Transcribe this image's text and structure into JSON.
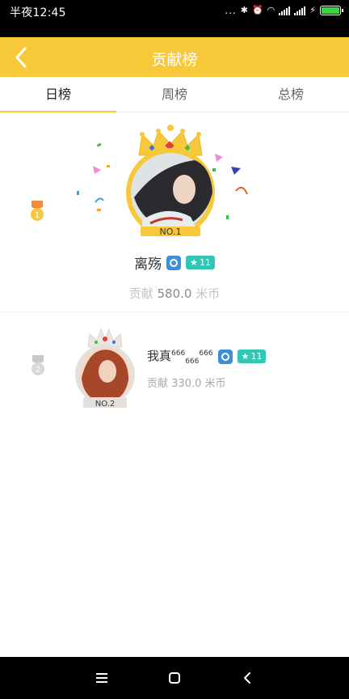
{
  "status_bar": {
    "time": "半夜12:45",
    "dots": "...",
    "bluetooth_icon": "bluetooth-icon",
    "alarm_icon": "alarm-icon",
    "wifi_icon": "wifi-icon"
  },
  "header": {
    "back_icon": "chevron-left-icon",
    "title": "贡献榜"
  },
  "tabs": [
    {
      "label": "日榜",
      "active": true
    },
    {
      "label": "周榜",
      "active": false
    },
    {
      "label": "总榜",
      "active": false
    }
  ],
  "ranking": [
    {
      "rank": 1,
      "rank_label": "NO.1",
      "medal_number": "1",
      "name": "离殇",
      "level": "11",
      "contribution_label": "贡献",
      "contribution_value": "580.0",
      "unit": "米币"
    },
    {
      "rank": 2,
      "rank_label": "NO.2",
      "medal_number": "2",
      "name_parts": [
        "我真",
        "666",
        "666",
        "666"
      ],
      "level": "11",
      "contribution_label": "贡献",
      "contribution_value": "330.0",
      "unit": "米币"
    }
  ],
  "nav": {
    "menu_icon": "menu-icon",
    "home_icon": "home-square-icon",
    "back_icon": "back-triangle-icon"
  },
  "colors": {
    "header_bg": "#f6c83a",
    "tab_indicator": "#f6c83a",
    "badge_blue": "#3c8fd9",
    "badge_teal": "#33c6b5",
    "battery": "#37d43c"
  }
}
